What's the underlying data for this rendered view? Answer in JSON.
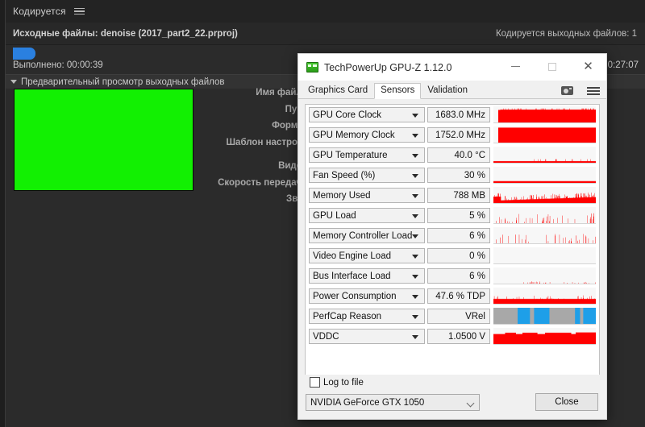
{
  "encoder": {
    "tab_title": "Кодируется",
    "menu_icon": "hamburger-icon",
    "source_files_label": "Исходные файлы: denoise (2017_part2_22.prproj)",
    "output_queue_label": "Кодируется выходных файлов: 1",
    "elapsed_label": "Выполнено: 00:00:39",
    "remaining_time": "0:27:07",
    "progress_percent": 7,
    "preview_section_title": "Предварительный просмотр выходных файлов",
    "preview_color": "#12f002",
    "meta_rows": [
      {
        "label": "Имя файла:",
        "value": ""
      },
      {
        "label": "Путь:",
        "value": ""
      },
      {
        "label": "Формат:",
        "value": ""
      },
      {
        "label": "Шаблон настроек:",
        "value": ""
      },
      {
        "label": "Видео:",
        "value": ""
      },
      {
        "label": "Скорость передачи:",
        "value": ""
      },
      {
        "label": "Звук:",
        "value": ""
      }
    ]
  },
  "gpuz": {
    "window_title": "TechPowerUp GPU-Z 1.12.0",
    "window_icon": "gpuz-logo-icon",
    "buttons": {
      "minimize": "minimize-icon",
      "maximize": "maximize-icon",
      "close": "✕"
    },
    "tabs": [
      {
        "label": "Graphics Card",
        "active": false
      },
      {
        "label": "Sensors",
        "active": true
      },
      {
        "label": "Validation",
        "active": false
      }
    ],
    "tab_icons": [
      "camera-icon",
      "menu-icon"
    ],
    "sensors": [
      {
        "name": "GPU Core Clock",
        "value": "1683.0 MHz",
        "graph": "high-block",
        "color": "#ff0000"
      },
      {
        "name": "GPU Memory Clock",
        "value": "1752.0 MHz",
        "graph": "full-block",
        "color": "#ff0000"
      },
      {
        "name": "GPU Temperature",
        "value": "40.0 °C",
        "graph": "low-line",
        "color": "#ff0000"
      },
      {
        "name": "Fan Speed (%)",
        "value": "30 %",
        "graph": "flat-line",
        "color": "#ff0000"
      },
      {
        "name": "Memory Used",
        "value": "788 MB",
        "graph": "rising-noise",
        "color": "#ff0000"
      },
      {
        "name": "GPU Load",
        "value": "5 %",
        "graph": "sparse-spikes",
        "color": "#ff0000"
      },
      {
        "name": "Memory Controller Load",
        "value": "6 %",
        "graph": "sparse-spikes2",
        "color": "#ff0000"
      },
      {
        "name": "Video Engine Load",
        "value": "0 %",
        "graph": "empty",
        "color": "#ff0000"
      },
      {
        "name": "Bus Interface Load",
        "value": "6 %",
        "graph": "tiny-dots",
        "color": "#ff0000"
      },
      {
        "name": "Power Consumption",
        "value": "47.6 % TDP",
        "graph": "mid-band",
        "color": "#ff0000"
      },
      {
        "name": "PerfCap Reason",
        "value": "VRel",
        "graph": "perfcap",
        "color": "#1e9fe8"
      },
      {
        "name": "VDDC",
        "value": "1.0500 V",
        "graph": "high-band",
        "color": "#ff0000"
      }
    ],
    "log_to_file": {
      "label": "Log to file",
      "checked": false
    },
    "gpu_select": {
      "value": "NVIDIA GeForce GTX 1050"
    },
    "close_button": "Close"
  }
}
